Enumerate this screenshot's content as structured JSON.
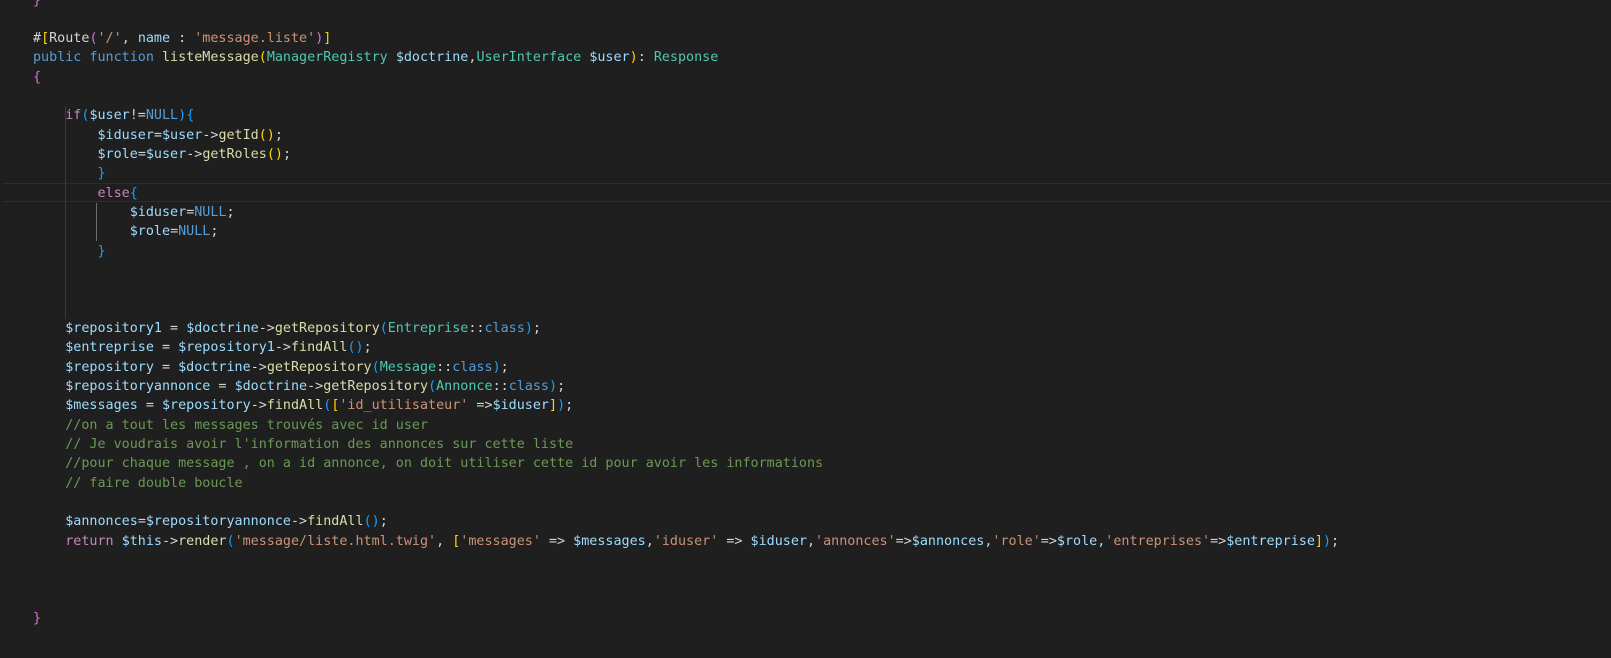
{
  "editor": {
    "theme": {
      "background": "#1f1f1f",
      "plain": "#d4d4d4",
      "keyword": "#569cd6",
      "control": "#c586c0",
      "function": "#dcdcaa",
      "variable": "#9cdcfe",
      "type": "#4ec9b0",
      "string": "#ce9178",
      "comment": "#6a9955",
      "bracket_level_1": "#ffd700",
      "bracket_level_2": "#da70d6",
      "bracket_level_3": "#179fff"
    },
    "lines": [
      [
        [
          "b2",
          "}"
        ]
      ],
      [],
      [
        [
          "plain",
          "#"
        ],
        [
          "b1",
          "["
        ],
        [
          "plain",
          "Route"
        ],
        [
          "b2",
          "("
        ],
        [
          "str",
          "'/'"
        ],
        [
          "plain",
          ", "
        ],
        [
          "var",
          "name"
        ],
        [
          "plain",
          " : "
        ],
        [
          "str",
          "'message.liste'"
        ],
        [
          "b2",
          ")"
        ],
        [
          "b1",
          "]"
        ]
      ],
      [
        [
          "kw",
          "public"
        ],
        [
          "plain",
          " "
        ],
        [
          "kw",
          "function"
        ],
        [
          "plain",
          " "
        ],
        [
          "fn",
          "listeMessage"
        ],
        [
          "b1",
          "("
        ],
        [
          "type",
          "ManagerRegistry"
        ],
        [
          "plain",
          " "
        ],
        [
          "var",
          "$doctrine"
        ],
        [
          "plain",
          ","
        ],
        [
          "type",
          "UserInterface"
        ],
        [
          "plain",
          " "
        ],
        [
          "var",
          "$user"
        ],
        [
          "b1",
          ")"
        ],
        [
          "plain",
          ": "
        ],
        [
          "type",
          "Response"
        ]
      ],
      [
        [
          "b2",
          "{"
        ]
      ],
      [],
      [
        [
          "plain",
          "    "
        ],
        [
          "ctl",
          "if"
        ],
        [
          "b3",
          "("
        ],
        [
          "var",
          "$user"
        ],
        [
          "plain",
          "!="
        ],
        [
          "kw",
          "NULL"
        ],
        [
          "b3",
          ")"
        ],
        [
          "b3",
          "{"
        ]
      ],
      [
        [
          "plain",
          "        "
        ],
        [
          "var",
          "$iduser"
        ],
        [
          "plain",
          "="
        ],
        [
          "var",
          "$user"
        ],
        [
          "plain",
          "->"
        ],
        [
          "fn",
          "getId"
        ],
        [
          "b1",
          "()"
        ],
        [
          "plain",
          ";"
        ]
      ],
      [
        [
          "plain",
          "        "
        ],
        [
          "var",
          "$role"
        ],
        [
          "plain",
          "="
        ],
        [
          "var",
          "$user"
        ],
        [
          "plain",
          "->"
        ],
        [
          "fn",
          "getRoles"
        ],
        [
          "b1",
          "()"
        ],
        [
          "plain",
          ";"
        ]
      ],
      [
        [
          "plain",
          "        "
        ],
        [
          "b3",
          "}"
        ]
      ],
      [
        [
          "plain",
          "        "
        ],
        [
          "ctl",
          "else"
        ],
        [
          "b3",
          "{"
        ]
      ],
      [
        [
          "plain",
          "            "
        ],
        [
          "var",
          "$iduser"
        ],
        [
          "plain",
          "="
        ],
        [
          "kw",
          "NULL"
        ],
        [
          "plain",
          ";"
        ]
      ],
      [
        [
          "plain",
          "            "
        ],
        [
          "var",
          "$role"
        ],
        [
          "plain",
          "="
        ],
        [
          "kw",
          "NULL"
        ],
        [
          "plain",
          ";"
        ]
      ],
      [
        [
          "plain",
          "        "
        ],
        [
          "b3",
          "}"
        ]
      ],
      [],
      [],
      [],
      [
        [
          "plain",
          "    "
        ],
        [
          "var",
          "$repository1"
        ],
        [
          "plain",
          " = "
        ],
        [
          "var",
          "$doctrine"
        ],
        [
          "plain",
          "->"
        ],
        [
          "fn",
          "getRepository"
        ],
        [
          "b3",
          "("
        ],
        [
          "type",
          "Entreprise"
        ],
        [
          "plain",
          "::"
        ],
        [
          "kw",
          "class"
        ],
        [
          "b3",
          ")"
        ],
        [
          "plain",
          ";"
        ]
      ],
      [
        [
          "plain",
          "    "
        ],
        [
          "var",
          "$entreprise"
        ],
        [
          "plain",
          " = "
        ],
        [
          "var",
          "$repository1"
        ],
        [
          "plain",
          "->"
        ],
        [
          "fn",
          "findAll"
        ],
        [
          "b3",
          "()"
        ],
        [
          "plain",
          ";"
        ]
      ],
      [
        [
          "plain",
          "    "
        ],
        [
          "var",
          "$repository"
        ],
        [
          "plain",
          " = "
        ],
        [
          "var",
          "$doctrine"
        ],
        [
          "plain",
          "->"
        ],
        [
          "fn",
          "getRepository"
        ],
        [
          "b3",
          "("
        ],
        [
          "type",
          "Message"
        ],
        [
          "plain",
          "::"
        ],
        [
          "kw",
          "class"
        ],
        [
          "b3",
          ")"
        ],
        [
          "plain",
          ";"
        ]
      ],
      [
        [
          "plain",
          "    "
        ],
        [
          "var",
          "$repositoryannonce"
        ],
        [
          "plain",
          " = "
        ],
        [
          "var",
          "$doctrine"
        ],
        [
          "plain",
          "->"
        ],
        [
          "fn",
          "getRepository"
        ],
        [
          "b3",
          "("
        ],
        [
          "type",
          "Annonce"
        ],
        [
          "plain",
          "::"
        ],
        [
          "kw",
          "class"
        ],
        [
          "b3",
          ")"
        ],
        [
          "plain",
          ";"
        ]
      ],
      [
        [
          "plain",
          "    "
        ],
        [
          "var",
          "$messages"
        ],
        [
          "plain",
          " = "
        ],
        [
          "var",
          "$repository"
        ],
        [
          "plain",
          "->"
        ],
        [
          "fn",
          "findAll"
        ],
        [
          "b3",
          "("
        ],
        [
          "b1",
          "["
        ],
        [
          "str",
          "'id_utilisateur'"
        ],
        [
          "plain",
          " =>"
        ],
        [
          "var",
          "$iduser"
        ],
        [
          "b1",
          "]"
        ],
        [
          "b3",
          ")"
        ],
        [
          "plain",
          ";"
        ]
      ],
      [
        [
          "plain",
          "    "
        ],
        [
          "cmt",
          "//on a tout les messages trouvés avec id user"
        ]
      ],
      [
        [
          "plain",
          "    "
        ],
        [
          "cmt",
          "// Je voudrais avoir l'information des annonces sur cette liste"
        ]
      ],
      [
        [
          "plain",
          "    "
        ],
        [
          "cmt",
          "//pour chaque message , on a id annonce, on doit utiliser cette id pour avoir les informations"
        ]
      ],
      [
        [
          "plain",
          "    "
        ],
        [
          "cmt",
          "// faire double boucle"
        ]
      ],
      [],
      [
        [
          "plain",
          "    "
        ],
        [
          "var",
          "$annonces"
        ],
        [
          "plain",
          "="
        ],
        [
          "var",
          "$repositoryannonce"
        ],
        [
          "plain",
          "->"
        ],
        [
          "fn",
          "findAll"
        ],
        [
          "b3",
          "()"
        ],
        [
          "plain",
          ";"
        ]
      ],
      [
        [
          "plain",
          "    "
        ],
        [
          "ctl",
          "return"
        ],
        [
          "plain",
          " "
        ],
        [
          "var",
          "$this"
        ],
        [
          "plain",
          "->"
        ],
        [
          "fn",
          "render"
        ],
        [
          "b3",
          "("
        ],
        [
          "str",
          "'message/liste.html.twig'"
        ],
        [
          "plain",
          ", "
        ],
        [
          "b1",
          "["
        ],
        [
          "str",
          "'messages'"
        ],
        [
          "plain",
          " => "
        ],
        [
          "var",
          "$messages"
        ],
        [
          "plain",
          ","
        ],
        [
          "str",
          "'iduser'"
        ],
        [
          "plain",
          " => "
        ],
        [
          "var",
          "$iduser"
        ],
        [
          "plain",
          ","
        ],
        [
          "str",
          "'annonces'"
        ],
        [
          "plain",
          "=>"
        ],
        [
          "var",
          "$annonces"
        ],
        [
          "plain",
          ","
        ],
        [
          "str",
          "'role'"
        ],
        [
          "plain",
          "=>"
        ],
        [
          "var",
          "$role"
        ],
        [
          "plain",
          ","
        ],
        [
          "str",
          "'entreprises'"
        ],
        [
          "plain",
          "=>"
        ],
        [
          "var",
          "$entreprise"
        ],
        [
          "b1",
          "]"
        ],
        [
          "b3",
          ")"
        ],
        [
          "plain",
          ";"
        ]
      ],
      [],
      [],
      [],
      [
        [
          "b2",
          "}"
        ]
      ]
    ]
  }
}
